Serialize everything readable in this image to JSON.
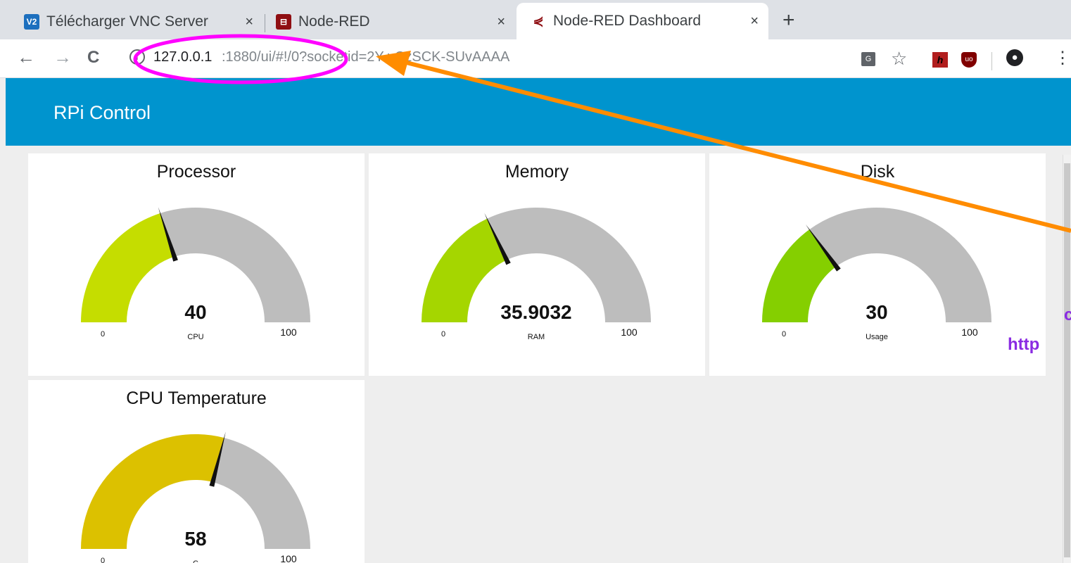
{
  "browser": {
    "tabs": [
      {
        "title": "Télécharger VNC Server",
        "favicon": "vnc-icon",
        "active": false
      },
      {
        "title": "Node-RED",
        "favicon": "node-red-icon",
        "active": false
      },
      {
        "title": "Node-RED Dashboard",
        "favicon": "node-red-dashboard-icon",
        "active": true
      }
    ],
    "tab_close_glyph": "×",
    "new_tab_glyph": "+",
    "url_host": "127.0.0.1",
    "url_rest": ":1880/ui/#!/0?socketid=2Y    yCzSCK-SUvAAAA"
  },
  "app": {
    "title": "RPi Control",
    "bar_color": "#0094ce",
    "background": "#eeeeee"
  },
  "gauges": [
    {
      "title": "Processor",
      "value": "40",
      "value_num": 40,
      "unit": "CPU",
      "min": "0",
      "max": "100",
      "color": "#c5dd00"
    },
    {
      "title": "Memory",
      "value": "35.9032",
      "value_num": 35.9032,
      "unit": "RAM",
      "min": "0",
      "max": "100",
      "color": "#a5d600"
    },
    {
      "title": "Disk",
      "value": "30",
      "value_num": 30,
      "unit": "Usage",
      "min": "0",
      "max": "100",
      "color": "#85cf00"
    },
    {
      "title": "CPU Temperature",
      "value": "58",
      "value_num": 58,
      "unit": "C",
      "min": "0",
      "max": "100",
      "color": "#dcc100"
    }
  ],
  "gauge_track_color": "#bdbdbd",
  "annotation": {
    "ellipse_color": "#ff00ff",
    "arrow_color": "#ff8c00",
    "text_color": "#8a2be2",
    "note_line1": "c",
    "note_line2": "http"
  }
}
